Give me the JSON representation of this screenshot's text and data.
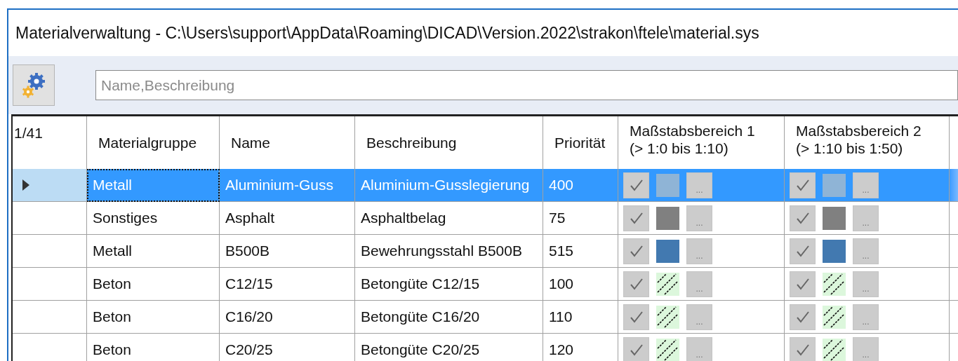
{
  "window": {
    "title": "Materialverwaltung - C:\\Users\\support\\AppData\\Roaming\\DICAD\\Version.2022\\strakon\\ftele\\material.sys"
  },
  "search": {
    "placeholder": "Name,Beschreibung"
  },
  "table": {
    "counter": "1/41",
    "columns": [
      "Materialgruppe",
      "Name",
      "Beschreibung",
      "Priorität"
    ],
    "scale_columns": [
      {
        "title": "Maßstabsbereich 1",
        "range": "(> 1:0 bis 1:10)"
      },
      {
        "title": "Maßstabsbereich 2",
        "range": "(> 1:10 bis 1:50)"
      }
    ],
    "rows": [
      {
        "selected": true,
        "cells": [
          "Metall",
          "Aluminium-Guss",
          "Aluminium-Gusslegierung",
          "400"
        ],
        "scales": [
          {
            "checked": true,
            "kind": "solid",
            "color": "#8fb4d6",
            "button": "..."
          },
          {
            "checked": true,
            "kind": "solid",
            "color": "#8fb4d6",
            "button": "..."
          }
        ]
      },
      {
        "selected": false,
        "cells": [
          "Sonstiges",
          "Asphalt",
          "Asphaltbelag",
          "75"
        ],
        "scales": [
          {
            "checked": true,
            "kind": "solid",
            "color": "#808080",
            "button": "..."
          },
          {
            "checked": true,
            "kind": "solid",
            "color": "#808080",
            "button": "..."
          }
        ]
      },
      {
        "selected": false,
        "cells": [
          "Metall",
          "B500B",
          "Bewehrungsstahl B500B",
          "515"
        ],
        "scales": [
          {
            "checked": true,
            "kind": "solid",
            "color": "#4279b0",
            "button": "..."
          },
          {
            "checked": true,
            "kind": "solid",
            "color": "#4279b0",
            "button": "..."
          }
        ]
      },
      {
        "selected": false,
        "cells": [
          "Beton",
          "C12/15",
          "Betongüte C12/15",
          "100"
        ],
        "scales": [
          {
            "checked": true,
            "kind": "hatch",
            "color": "#dcf7dc",
            "button": "..."
          },
          {
            "checked": true,
            "kind": "hatch",
            "color": "#dcf7dc",
            "button": "..."
          }
        ]
      },
      {
        "selected": false,
        "cells": [
          "Beton",
          "C16/20",
          "Betongüte C16/20",
          "110"
        ],
        "scales": [
          {
            "checked": true,
            "kind": "hatch",
            "color": "#dcf7dc",
            "button": "..."
          },
          {
            "checked": true,
            "kind": "hatch",
            "color": "#dcf7dc",
            "button": "..."
          }
        ]
      },
      {
        "selected": false,
        "cells": [
          "Beton",
          "C20/25",
          "Betongüte C20/25",
          "120"
        ],
        "scales": [
          {
            "checked": true,
            "kind": "hatch",
            "color": "#dcf7dc",
            "button": "..."
          },
          {
            "checked": true,
            "kind": "hatch",
            "color": "#dcf7dc",
            "button": "..."
          }
        ]
      }
    ]
  }
}
